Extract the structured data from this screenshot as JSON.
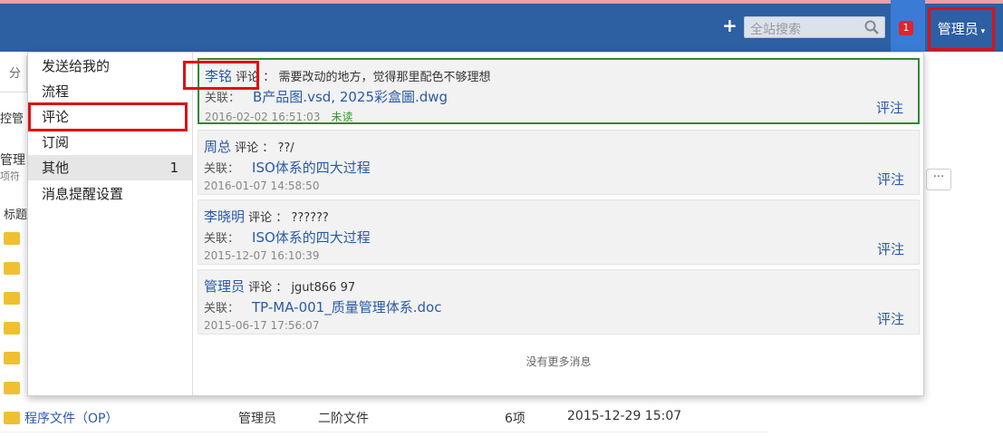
{
  "navbar": {
    "search_placeholder": "全站搜索",
    "notification_count": "1",
    "user_label": "管理员"
  },
  "background": {
    "tab_label": "分",
    "control_label": "控管",
    "manage_label": "管理",
    "manage_sub": "项符",
    "title_header": "标题",
    "row": {
      "name": "程序文件（OP）",
      "owner": "管理员",
      "type": "二阶文件",
      "count": "6项",
      "date": "2015-12-29 15:07"
    },
    "more_button": "···"
  },
  "dropdown": {
    "sidebar": [
      {
        "label": "发送给我的",
        "count": ""
      },
      {
        "label": "流程",
        "count": ""
      },
      {
        "label": "评论",
        "count": ""
      },
      {
        "label": "订阅",
        "count": ""
      },
      {
        "label": "其他",
        "count": "1"
      },
      {
        "label": "消息提醒设置",
        "count": ""
      }
    ],
    "related_label": "关联：",
    "reply_label": "评注",
    "messages": [
      {
        "author": "李铭",
        "action": "评论 ：",
        "text": "需要改动的地方，觉得那里配色不够理想",
        "files": "B产品图.vsd, 2025彩盒圖.dwg",
        "time": "2016-02-02 16:51:03",
        "status": "未读"
      },
      {
        "author": "周总",
        "action": "评论 ：",
        "text": "??/",
        "files": "ISO体系的四大过程",
        "time": "2016-01-07 14:58:50",
        "status": ""
      },
      {
        "author": "李晓明",
        "action": "评论 ：",
        "text": "??????",
        "files": "ISO体系的四大过程",
        "time": "2015-12-07 16:10:39",
        "status": ""
      },
      {
        "author": "管理员",
        "action": "评论 ：",
        "text": "jgut866 97",
        "files": "TP-MA-001_质量管理体系.doc",
        "time": "2015-06-17 17:56:07",
        "status": ""
      }
    ],
    "no_more": "没有更多消息"
  },
  "colors": {
    "navbar": "#2d5fa3",
    "highlight": "#e01010",
    "link": "#2a5aa8",
    "unread": "#2e9b2e"
  }
}
